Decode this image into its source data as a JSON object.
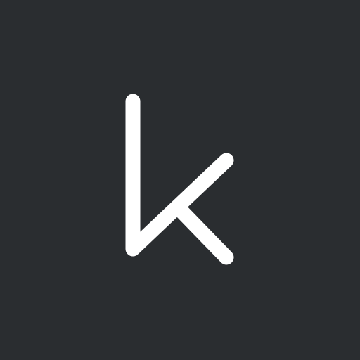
{
  "logo": {
    "icon": "letter-k-logo-icon",
    "background_color": "#2a2d30",
    "glyph_color": "#ffffff"
  }
}
